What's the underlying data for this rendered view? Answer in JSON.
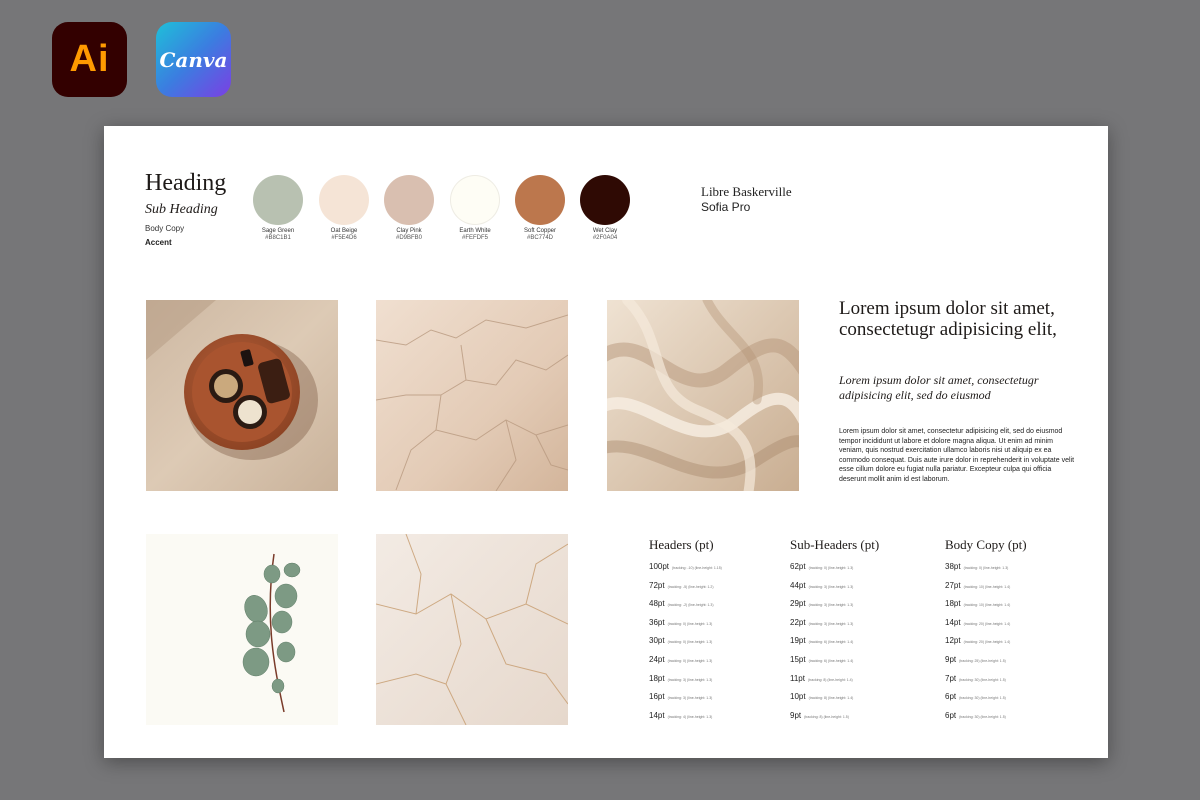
{
  "apps": {
    "ai_label": "Ai",
    "canva_label": "Canva"
  },
  "typography": {
    "heading": "Heading",
    "sub_heading": "Sub Heading",
    "body_copy": "Body Copy",
    "accent": "Accent"
  },
  "swatches": [
    {
      "name": "Sage Green",
      "hex": "#B8C1B1",
      "color": "#B8C1B1"
    },
    {
      "name": "Oat Beige",
      "hex": "#F5E4D6",
      "color": "#F5E4D6"
    },
    {
      "name": "Clay Pink",
      "hex": "#D9BFB0",
      "color": "#D9BFB0"
    },
    {
      "name": "Earth White",
      "hex": "#FEFDF5",
      "color": "#FEFDF5"
    },
    {
      "name": "Soft Copper",
      "hex": "#BC774D",
      "color": "#BC774D"
    },
    {
      "name": "Wet Clay",
      "hex": "#2F0A04",
      "color": "#2F0A04"
    }
  ],
  "fonts": {
    "primary": "Libre Baskerville",
    "secondary": "Sofia Pro"
  },
  "lorem": {
    "big": "Lorem ipsum dolor sit amet, consectetugr adipisicing elit,",
    "italic": "Lorem ipsum dolor sit amet, consectetugr adipisicing elit, sed do eiusmod",
    "small": "Lorem ipsum dolor sit amet, consectetur adipisicing elit, sed do eiusmod tempor incididunt ut labore et dolore magna aliqua. Ut enim ad minim veniam, quis nostrud exercitation ullamco laboris nisi ut aliquip ex ea commodo consequat. Duis aute irure dolor in reprehenderit in voluptate velit esse cillum dolore eu fugiat nulla pariatur. Excepteur culpa qui officia deserunt mollit anim id est laborum."
  },
  "scale": {
    "headers": {
      "title": "Headers (pt)",
      "rows": [
        {
          "size": "100pt",
          "meta": "(tracking: -10) (line-height: 1.15)"
        },
        {
          "size": "72pt",
          "meta": "(tracking: -5) (line-height: 1.2)"
        },
        {
          "size": "48pt",
          "meta": "(tracking: -2) (line-height: 1.3)"
        },
        {
          "size": "36pt",
          "meta": "(tracking: 0) (line-height: 1.3)"
        },
        {
          "size": "30pt",
          "meta": "(tracking: 0) (line-height: 1.3)"
        },
        {
          "size": "24pt",
          "meta": "(tracking: 0) (line-height: 1.3)"
        },
        {
          "size": "18pt",
          "meta": "(tracking: 3) (line-height: 1.3)"
        },
        {
          "size": "16pt",
          "meta": "(tracking: 3) (line-height: 1.3)"
        },
        {
          "size": "14pt",
          "meta": "(tracking: 4) (line-height: 1.3)"
        }
      ]
    },
    "subheaders": {
      "title": "Sub-Headers (pt)",
      "rows": [
        {
          "size": "62pt",
          "meta": "(tracking: 0) (line-height: 1.3)"
        },
        {
          "size": "44pt",
          "meta": "(tracking: 3) (line-height: 1.3)"
        },
        {
          "size": "29pt",
          "meta": "(tracking: 3) (line-height: 1.3)"
        },
        {
          "size": "22pt",
          "meta": "(tracking: 3) (line-height: 1.3)"
        },
        {
          "size": "19pt",
          "meta": "(tracking: 6) (line-height: 1.4)"
        },
        {
          "size": "15pt",
          "meta": "(tracking: 6) (line-height: 1.4)"
        },
        {
          "size": "11pt",
          "meta": "(tracking: 8) (line-height: 1.4)"
        },
        {
          "size": "10pt",
          "meta": "(tracking: 8) (line-height: 1.4)"
        },
        {
          "size": "9pt",
          "meta": "(tracking: 8) (line-height: 1.5)"
        }
      ]
    },
    "body": {
      "title": "Body Copy (pt)",
      "rows": [
        {
          "size": "38pt",
          "meta": "(tracking: 0) (line-height: 1.3)"
        },
        {
          "size": "27pt",
          "meta": "(tracking: 10) (line-height: 1.4)"
        },
        {
          "size": "18pt",
          "meta": "(tracking: 10) (line-height: 1.4)"
        },
        {
          "size": "14pt",
          "meta": "(tracking: 20) (line-height: 1.4)"
        },
        {
          "size": "12pt",
          "meta": "(tracking: 20) (line-height: 1.4)"
        },
        {
          "size": "9pt",
          "meta": "(tracking: 25) (line-height: 1.5)"
        },
        {
          "size": "7pt",
          "meta": "(tracking: 30) (line-height: 1.5)"
        },
        {
          "size": "6pt",
          "meta": "(tracking: 30) (line-height: 1.5)"
        },
        {
          "size": "6pt",
          "meta": "(tracking: 30) (line-height: 1.5)"
        }
      ]
    }
  }
}
